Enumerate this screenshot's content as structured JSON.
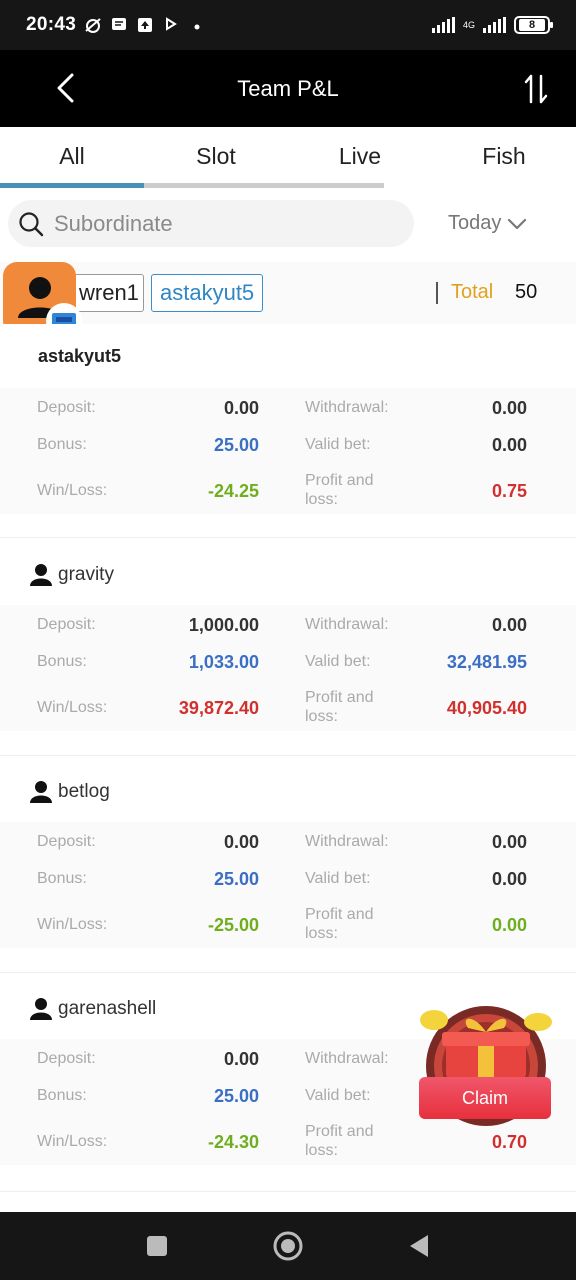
{
  "status": {
    "time": "20:43",
    "network": "4G",
    "battery": "8"
  },
  "header": {
    "title": "Team P&L"
  },
  "tabs": [
    {
      "label": "All"
    },
    {
      "label": "Slot"
    },
    {
      "label": "Live"
    },
    {
      "label": "Fish"
    }
  ],
  "search": {
    "placeholder": "Subordinate"
  },
  "date_filter": "Today",
  "chips": [
    {
      "label": "wren1"
    },
    {
      "label": "astakyut5"
    }
  ],
  "total": {
    "label": "Total",
    "value": "50"
  },
  "labels": {
    "deposit": "Deposit:",
    "withdrawal": "Withdrawal:",
    "bonus": "Bonus:",
    "valid_bet": "Valid bet:",
    "win_loss": "Win/Loss:",
    "profit_loss_1": "Profit and",
    "profit_loss_2": "loss:"
  },
  "users": [
    {
      "name": "astakyut5",
      "deposit": "0.00",
      "withdrawal": "0.00",
      "bonus": "25.00",
      "valid_bet": "0.00",
      "win_loss": "-24.25",
      "profit_loss": "0.75"
    },
    {
      "name": "gravity",
      "deposit": "1,000.00",
      "withdrawal": "0.00",
      "bonus": "1,033.00",
      "valid_bet": "32,481.95",
      "win_loss": "39,872.40",
      "profit_loss": "40,905.40"
    },
    {
      "name": "betlog",
      "deposit": "0.00",
      "withdrawal": "0.00",
      "bonus": "25.00",
      "valid_bet": "0.00",
      "win_loss": "-25.00",
      "profit_loss": "0.00"
    },
    {
      "name": "garenashell",
      "deposit": "0.00",
      "withdrawal": "",
      "bonus": "25.00",
      "valid_bet": "",
      "win_loss": "-24.30",
      "profit_loss": "0.70"
    }
  ],
  "claim": {
    "label": "Claim"
  },
  "colors": {
    "blue": "#3a6fc4",
    "green": "#6fae1e",
    "red": "#d0302e",
    "dark": "#333333",
    "gold": "#e0a11e"
  }
}
